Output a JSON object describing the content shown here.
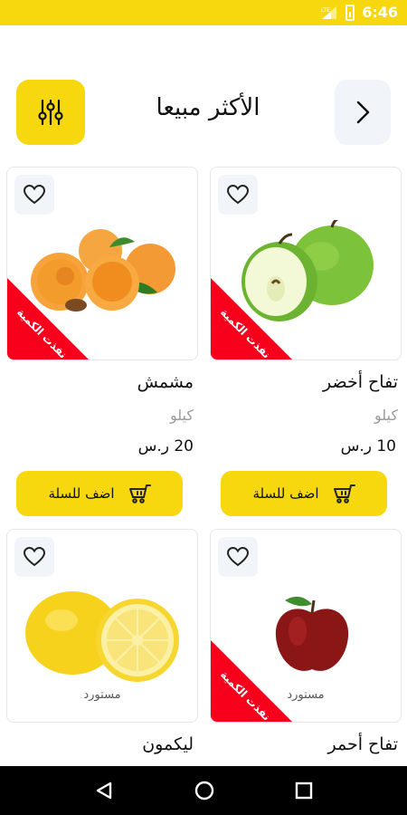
{
  "status_bar": {
    "time": "6:46",
    "signal_label": "LTE"
  },
  "header": {
    "title": "الأكثر مبيعا",
    "filter_icon": "sliders-icon",
    "back_icon": "chevron-right-icon"
  },
  "products": [
    {
      "name": "تفاح أخضر",
      "unit": "كيلو",
      "price": "10 ر.س",
      "sold_out_label": "نفذت الكمية",
      "sold_out": true,
      "origin": "",
      "add_label": "اضف للسلة"
    },
    {
      "name": "مشمش",
      "unit": "كيلو",
      "price": "20 ر.س",
      "sold_out_label": "نفذت الكمية",
      "sold_out": true,
      "origin": "",
      "add_label": "اضف للسلة"
    },
    {
      "name": "تفاح أحمر",
      "unit": "",
      "price": "",
      "sold_out_label": "نفذت الكمية",
      "sold_out": true,
      "origin": "مستورد",
      "add_label": ""
    },
    {
      "name": "ليكمون",
      "unit": "",
      "price": "",
      "sold_out_label": "",
      "sold_out": false,
      "origin": "مستورد",
      "add_label": ""
    }
  ],
  "colors": {
    "accent": "#F7D80F",
    "sold_out": "#F8001B",
    "soft_bg": "#F1F4F8"
  }
}
